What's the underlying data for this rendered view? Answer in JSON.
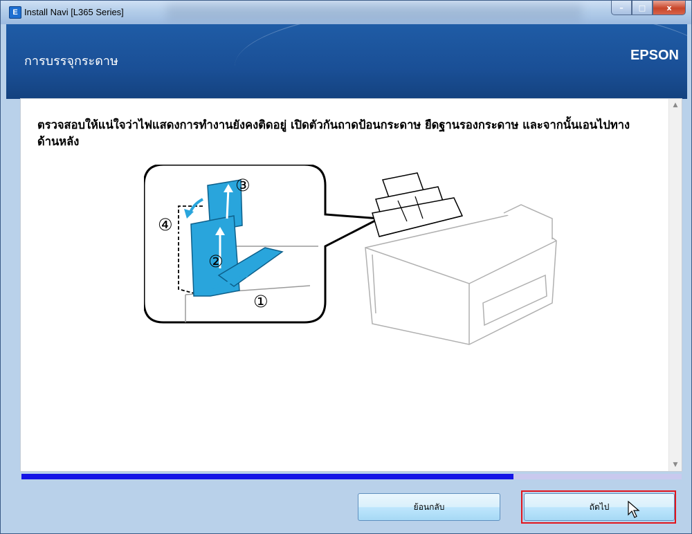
{
  "window": {
    "title": "Install Navi [L365 Series]",
    "app_icon_letter": "E",
    "controls": {
      "minimize": "–",
      "maximize": "□",
      "close": "x"
    }
  },
  "header": {
    "title": "การบรรจุกระดาษ",
    "brand": "EPSON"
  },
  "content": {
    "instruction": "ตรวจสอบให้แน่ใจว่าไฟแสดงการทำงานยังคงติดอยู่ เปิดตัวกันถาดป้อนกระดาษ ยืดฐานรองกระดาษ และจากนั้นเอนไปทางด้านหลัง",
    "steps": [
      "①",
      "②",
      "③",
      "④"
    ]
  },
  "progress": {
    "value": 0.745
  },
  "buttons": {
    "back": "ย้อนกลับ",
    "next": "ถัดไป"
  },
  "colors": {
    "header": "#1a4f96",
    "progress_fill": "#1515e6",
    "progress_track": "#c9c9ee",
    "highlight": "#e2141c",
    "illustration_blue": "#29a5dc"
  }
}
